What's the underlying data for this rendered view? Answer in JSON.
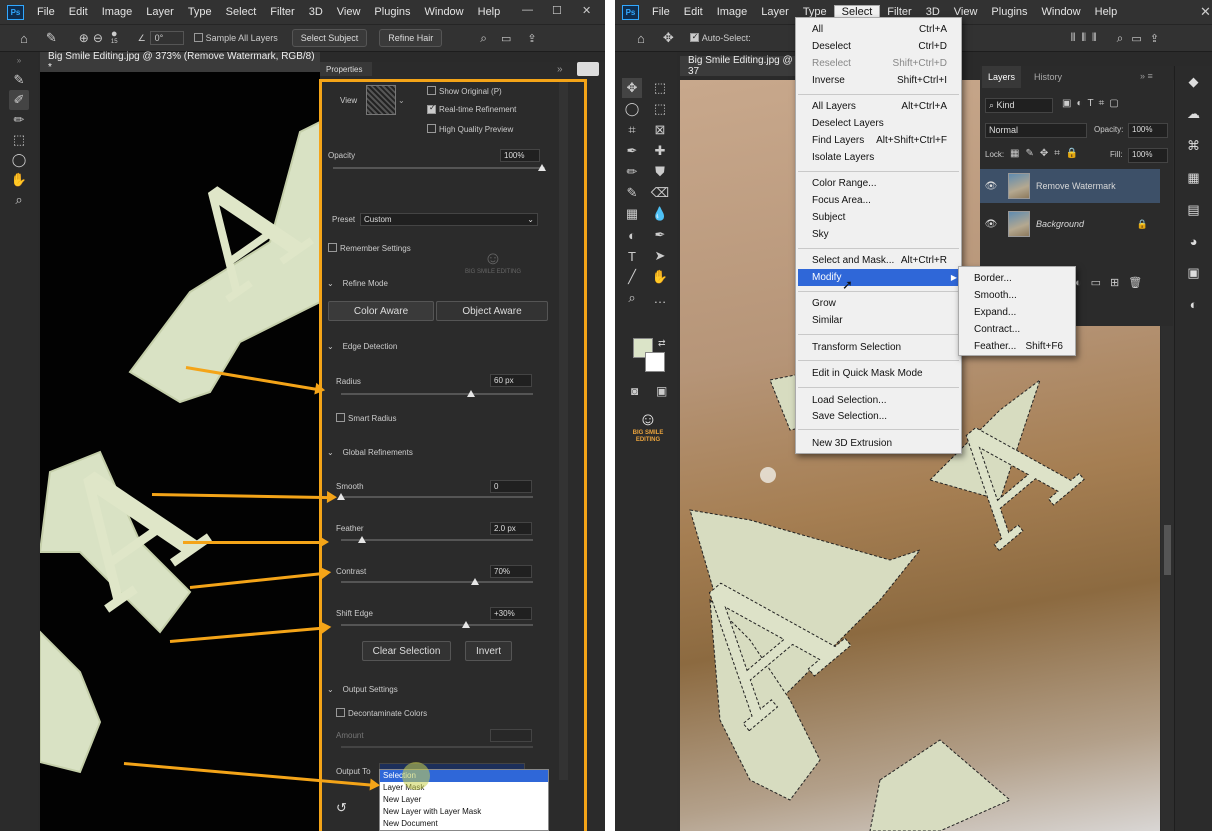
{
  "left": {
    "menubar": [
      "File",
      "Edit",
      "Image",
      "Layer",
      "Type",
      "Select",
      "Filter",
      "3D",
      "View",
      "Plugins",
      "Window",
      "Help"
    ],
    "logo": "Ps",
    "options": {
      "brush_size": "15",
      "angle": "0°",
      "sample_all_layers": "Sample All Layers",
      "select_subject": "Select Subject",
      "refine_hair": "Refine Hair"
    },
    "doc_tab": "Big Smile Editing.jpg @ 373% (Remove Watermark, RGB/8) *",
    "panel_title": "Properties",
    "view_label": "View",
    "show_original": "Show Original (P)",
    "realtime_refinement": "Real-time Refinement",
    "high_quality_preview": "High Quality Preview",
    "opacity_label": "Opacity",
    "opacity_value": "100%",
    "preset_label": "Preset",
    "preset_value": "Custom",
    "remember_settings": "Remember Settings",
    "watermark_text": "BIG SMILE EDITING",
    "refine_mode": "Refine Mode",
    "color_aware": "Color Aware",
    "object_aware": "Object Aware",
    "edge_detection": "Edge Detection",
    "radius_label": "Radius",
    "radius_value": "60 px",
    "smart_radius": "Smart Radius",
    "global_refinements": "Global Refinements",
    "smooth_label": "Smooth",
    "smooth_value": "0",
    "feather_label": "Feather",
    "feather_value": "2.0 px",
    "contrast_label": "Contrast",
    "contrast_value": "70%",
    "shift_edge_label": "Shift Edge",
    "shift_edge_value": "+30%",
    "clear_selection": "Clear Selection",
    "invert": "Invert",
    "output_settings": "Output Settings",
    "decontaminate": "Decontaminate Colors",
    "amount_label": "Amount",
    "output_to_label": "Output To",
    "output_options": [
      "Selection",
      "Layer Mask",
      "New Layer",
      "New Layer with Layer Mask",
      "New Document"
    ],
    "canvas_letters": [
      "A",
      "T",
      "A",
      "A"
    ]
  },
  "right": {
    "menubar": [
      "File",
      "Edit",
      "Image",
      "Layer",
      "Type",
      "Select",
      "Filter",
      "3D",
      "View",
      "Plugins",
      "Window",
      "Help"
    ],
    "logo": "Ps",
    "auto_select": "Auto-Select:",
    "doc_tab": "Big Smile Editing.jpg @ 37",
    "select_menu": [
      {
        "label": "All",
        "shortcut": "Ctrl+A"
      },
      {
        "label": "Deselect",
        "shortcut": "Ctrl+D"
      },
      {
        "label": "Reselect",
        "shortcut": "Shift+Ctrl+D"
      },
      {
        "label": "Inverse",
        "shortcut": "Shift+Ctrl+I"
      },
      {
        "label": "All Layers",
        "shortcut": "Alt+Ctrl+A"
      },
      {
        "label": "Deselect Layers",
        "shortcut": ""
      },
      {
        "label": "Find Layers",
        "shortcut": "Alt+Shift+Ctrl+F"
      },
      {
        "label": "Isolate Layers",
        "shortcut": ""
      },
      {
        "label": "Color Range...",
        "shortcut": ""
      },
      {
        "label": "Focus Area...",
        "shortcut": ""
      },
      {
        "label": "Subject",
        "shortcut": ""
      },
      {
        "label": "Sky",
        "shortcut": ""
      },
      {
        "label": "Select and Mask...",
        "shortcut": "Alt+Ctrl+R"
      },
      {
        "label": "Modify",
        "shortcut": ""
      },
      {
        "label": "Grow",
        "shortcut": ""
      },
      {
        "label": "Similar",
        "shortcut": ""
      },
      {
        "label": "Transform Selection",
        "shortcut": ""
      },
      {
        "label": "Edit in Quick Mask Mode",
        "shortcut": ""
      },
      {
        "label": "Load Selection...",
        "shortcut": ""
      },
      {
        "label": "Save Selection...",
        "shortcut": ""
      },
      {
        "label": "New 3D Extrusion",
        "shortcut": ""
      }
    ],
    "modify_submenu": [
      {
        "label": "Border...",
        "shortcut": ""
      },
      {
        "label": "Smooth...",
        "shortcut": ""
      },
      {
        "label": "Expand...",
        "shortcut": ""
      },
      {
        "label": "Contract...",
        "shortcut": ""
      },
      {
        "label": "Feather...",
        "shortcut": "Shift+F6"
      }
    ],
    "layers_tab": "Layers",
    "history_tab": "History",
    "kind": "Kind",
    "blend_mode": "Normal",
    "opacity_label": "Opacity:",
    "opacity_value": "100%",
    "lock_label": "Lock:",
    "fill_label": "Fill:",
    "fill_value": "100%",
    "layer1": "Remove Watermark",
    "layer2": "Background",
    "logo_text": "BIG SMILE EDITING",
    "canvas_letters": [
      "A",
      "A"
    ]
  },
  "colors": {
    "accent": "#f4a418",
    "highlight": "#2f67d8",
    "panel": "#2b2b2b"
  }
}
